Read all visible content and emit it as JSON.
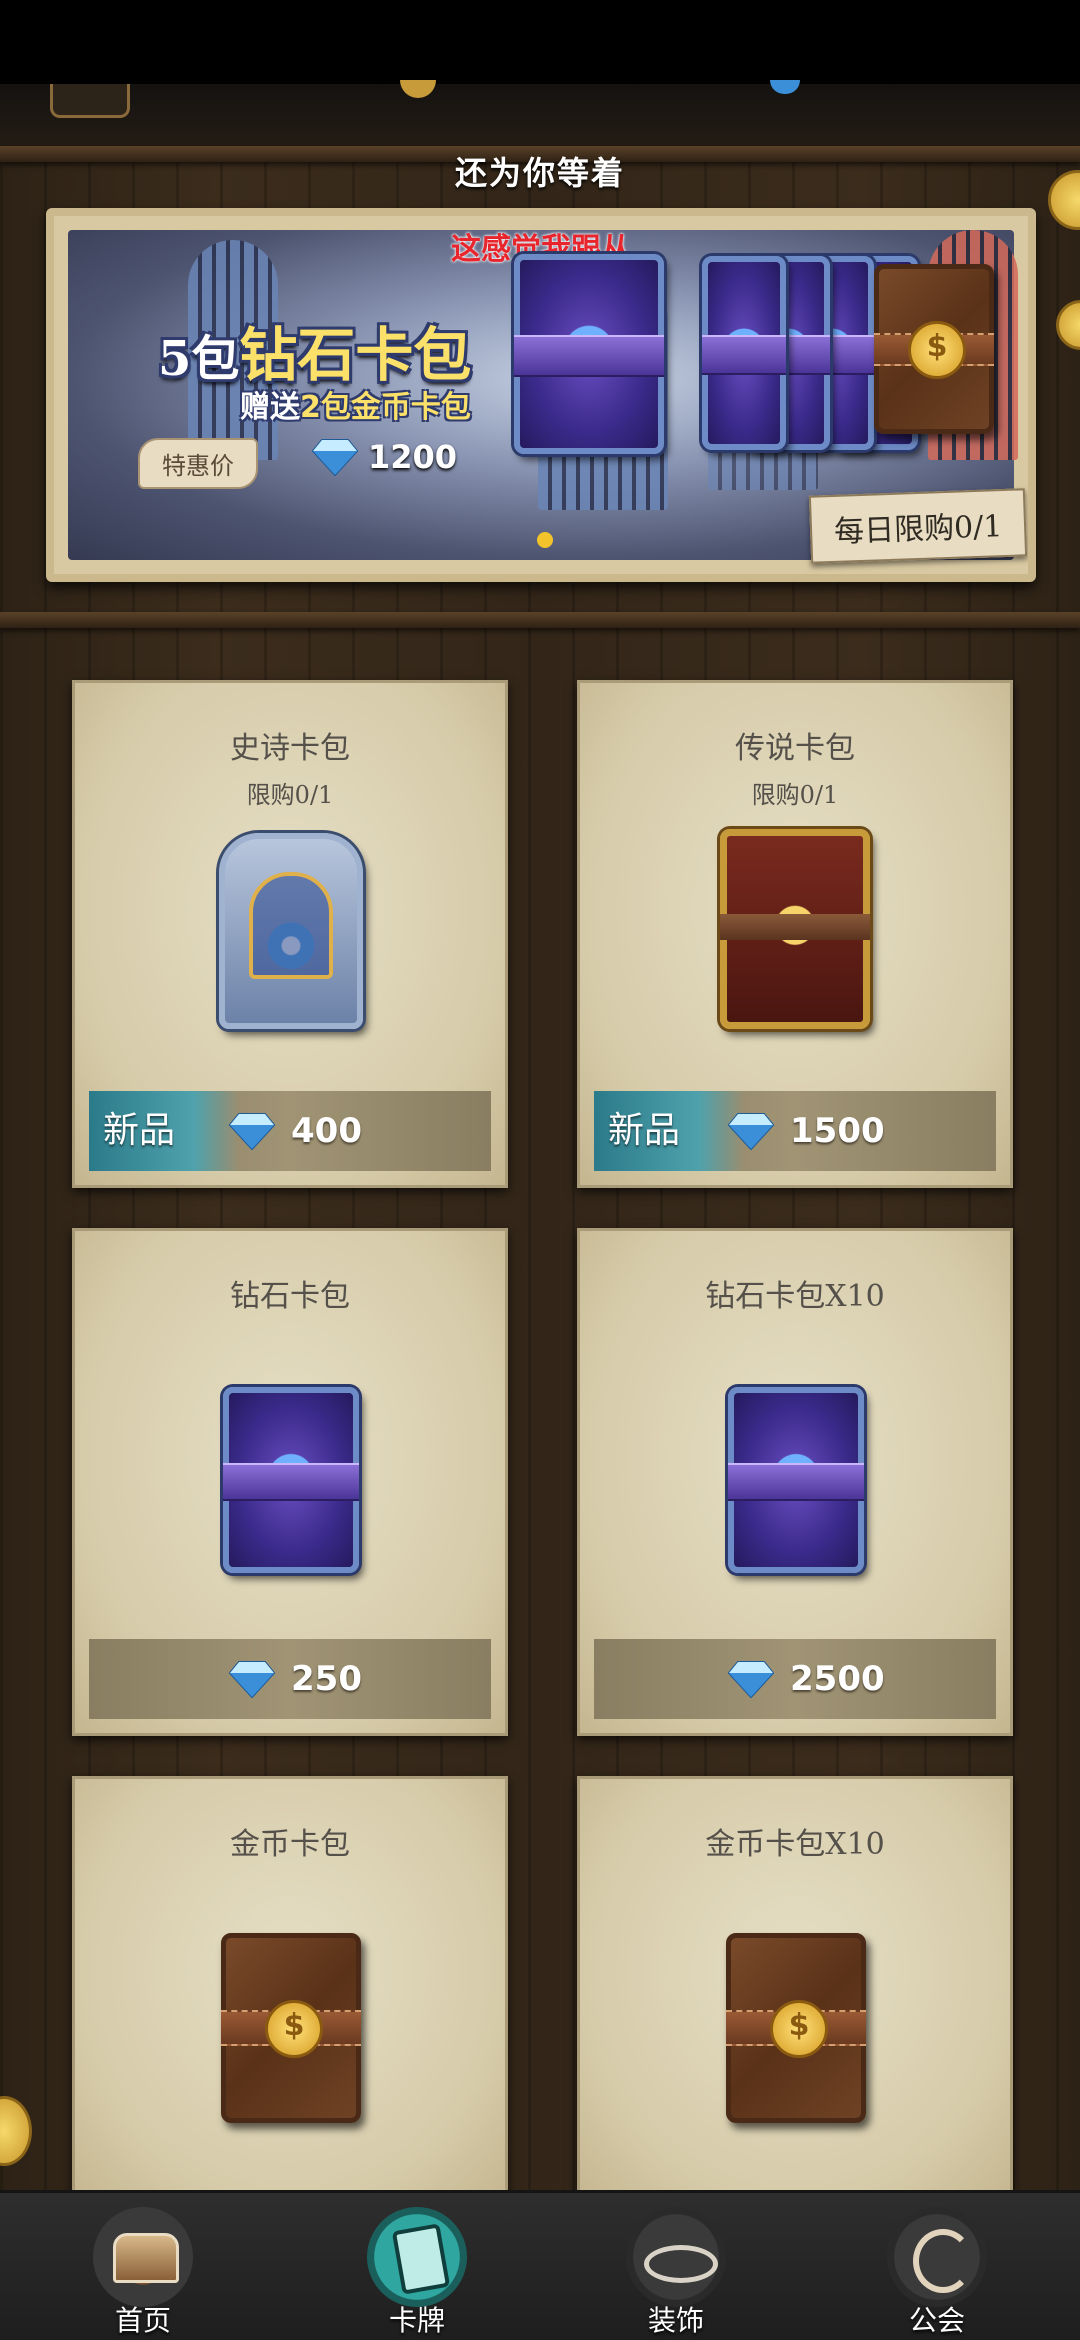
{
  "header": {
    "waiting_text": "还为你等着"
  },
  "banner": {
    "top_text": "这感觉我跟从",
    "title_num": "5包",
    "title_text": "钻石卡包",
    "sub_prefix": "赠送",
    "sub_num": "2包",
    "sub_gold": "金币卡包",
    "deal_label": "特惠价",
    "price": "1200",
    "daily_limit": "每日限购0/1"
  },
  "products": [
    {
      "name": "史诗卡包",
      "limit": "限购0/1",
      "badge": "新品",
      "price": "400",
      "art": "epic-pack"
    },
    {
      "name": "传说卡包",
      "limit": "限购0/1",
      "badge": "新品",
      "price": "1500",
      "art": "legendary-pack"
    },
    {
      "name": "钻石卡包",
      "limit": "",
      "badge": "",
      "price": "250",
      "art": "diamond-pack"
    },
    {
      "name": "钻石卡包X10",
      "limit": "",
      "badge": "",
      "price": "2500",
      "art": "diamond-pack"
    },
    {
      "name": "金币卡包",
      "limit": "",
      "badge": "",
      "price": "",
      "art": "gold-pack"
    },
    {
      "name": "金币卡包X10",
      "limit": "",
      "badge": "",
      "price": "",
      "art": "gold-pack"
    }
  ],
  "nav": [
    {
      "label": "首页",
      "icon": "treasure-chest-icon",
      "active": false
    },
    {
      "label": "卡牌",
      "icon": "cards-icon",
      "active": true
    },
    {
      "label": "装饰",
      "icon": "decoration-icon",
      "active": false
    },
    {
      "label": "公会",
      "icon": "guild-icon",
      "active": false
    }
  ],
  "colors": {
    "gem": "#4aa8f0",
    "new_badge": "#2b7a8a",
    "active_nav": "#2fa7a0",
    "banner_red": "#e8242c",
    "title_gold": "#fbe06a"
  }
}
